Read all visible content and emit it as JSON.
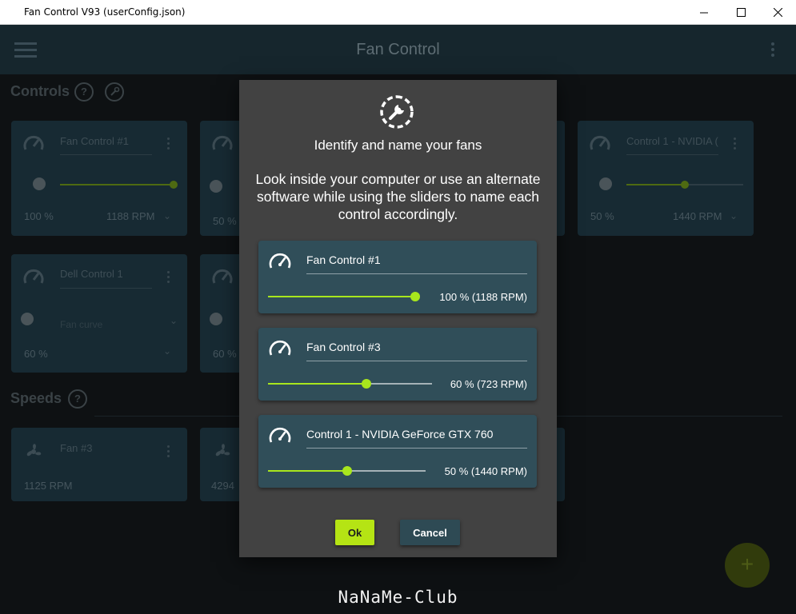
{
  "window": {
    "title": "Fan Control V93 (userConfig.json)",
    "minimize_icon": "minimize-icon",
    "maximize_icon": "maximize-icon",
    "close_icon": "close-icon"
  },
  "appbar": {
    "title": "Fan Control",
    "menu_icon": "hamburger-menu-icon",
    "more_icon": "more-vertical-icon"
  },
  "controls_section": {
    "title": "Controls",
    "help_label": "?",
    "tools_icon": "wrench-icon",
    "cards": [
      {
        "name": "Fan Control #1",
        "percent": "100 %",
        "rpm": "1188 RPM",
        "slider_fraction": 1.0
      },
      {
        "name": "",
        "percent": "50 %",
        "rpm": "",
        "slider_fraction": 0.5
      },
      {
        "name": "Control 1 - NVIDIA (",
        "percent": "50 %",
        "rpm": "1440 RPM",
        "slider_fraction": 0.5
      },
      {
        "name": "Dell Control 1",
        "percent": "60 %",
        "sub": "Fan curve"
      },
      {
        "name": "",
        "percent": "60 %"
      }
    ]
  },
  "speeds_section": {
    "title": "Speeds",
    "help_label": "?",
    "cards": [
      {
        "name": "Fan #3",
        "rpm": "1125 RPM"
      },
      {
        "name": "",
        "rpm": "4294"
      }
    ]
  },
  "fab": {
    "label": "+"
  },
  "watermark": "NaNaMe-Club",
  "dialog": {
    "icon": "wrench-gear-icon",
    "title": "Identify and name your fans",
    "description": "Look inside your computer or use an alternate software while using the sliders to name each control accordingly.",
    "fans": [
      {
        "name": "Fan Control #1",
        "value": "100 % (1188 RPM)",
        "slider_fraction": 1.0
      },
      {
        "name": "Fan Control #3",
        "value": "60 % (723 RPM)",
        "slider_fraction": 0.6
      },
      {
        "name": "Control 1 - NVIDIA GeForce GTX 760",
        "value": "50 % (1440 RPM)",
        "slider_fraction": 0.5
      }
    ],
    "ok_label": "Ok",
    "cancel_label": "Cancel"
  },
  "colors": {
    "accent": "#a8e61d",
    "dialog_bg": "#424242",
    "fan_card_bg": "#304e59",
    "app_bg": "#0e1113"
  }
}
